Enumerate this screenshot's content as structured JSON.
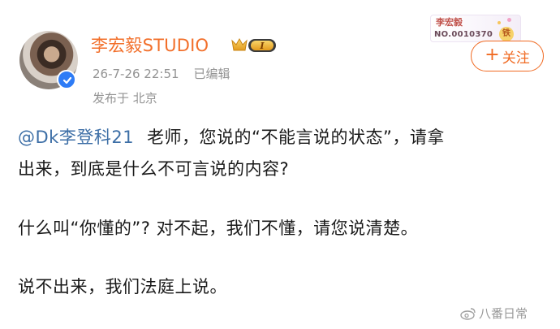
{
  "profile": {
    "username": "李宏毅STUDIO",
    "vip_level": "I",
    "timestamp": "26-7-26 22:51",
    "edited_label": "已编辑",
    "location": "发布于 北京",
    "verified_color": "#2e7cf6"
  },
  "fan_card": {
    "name": "李宏毅",
    "number": "NO.0010370",
    "tag": "铁"
  },
  "follow_button": {
    "plus": "+",
    "label": "关注"
  },
  "post": {
    "mention": "@Dk李登科21",
    "line1": "老师，您说的“不能言说的状态”，请拿",
    "line2": "出来，到底是什么不可言说的内容?",
    "paragraph2": "什么叫“你懂的”? 对不起，我们不懂，请您说清楚。",
    "paragraph3": "说不出来，我们法庭上说。"
  },
  "watermark": {
    "text": "八番日常",
    "icon": "weibo-icon"
  },
  "colors": {
    "accent": "#f06a22",
    "username": "#f26f2a",
    "mention": "#3c6ea6",
    "meta": "#939393"
  }
}
